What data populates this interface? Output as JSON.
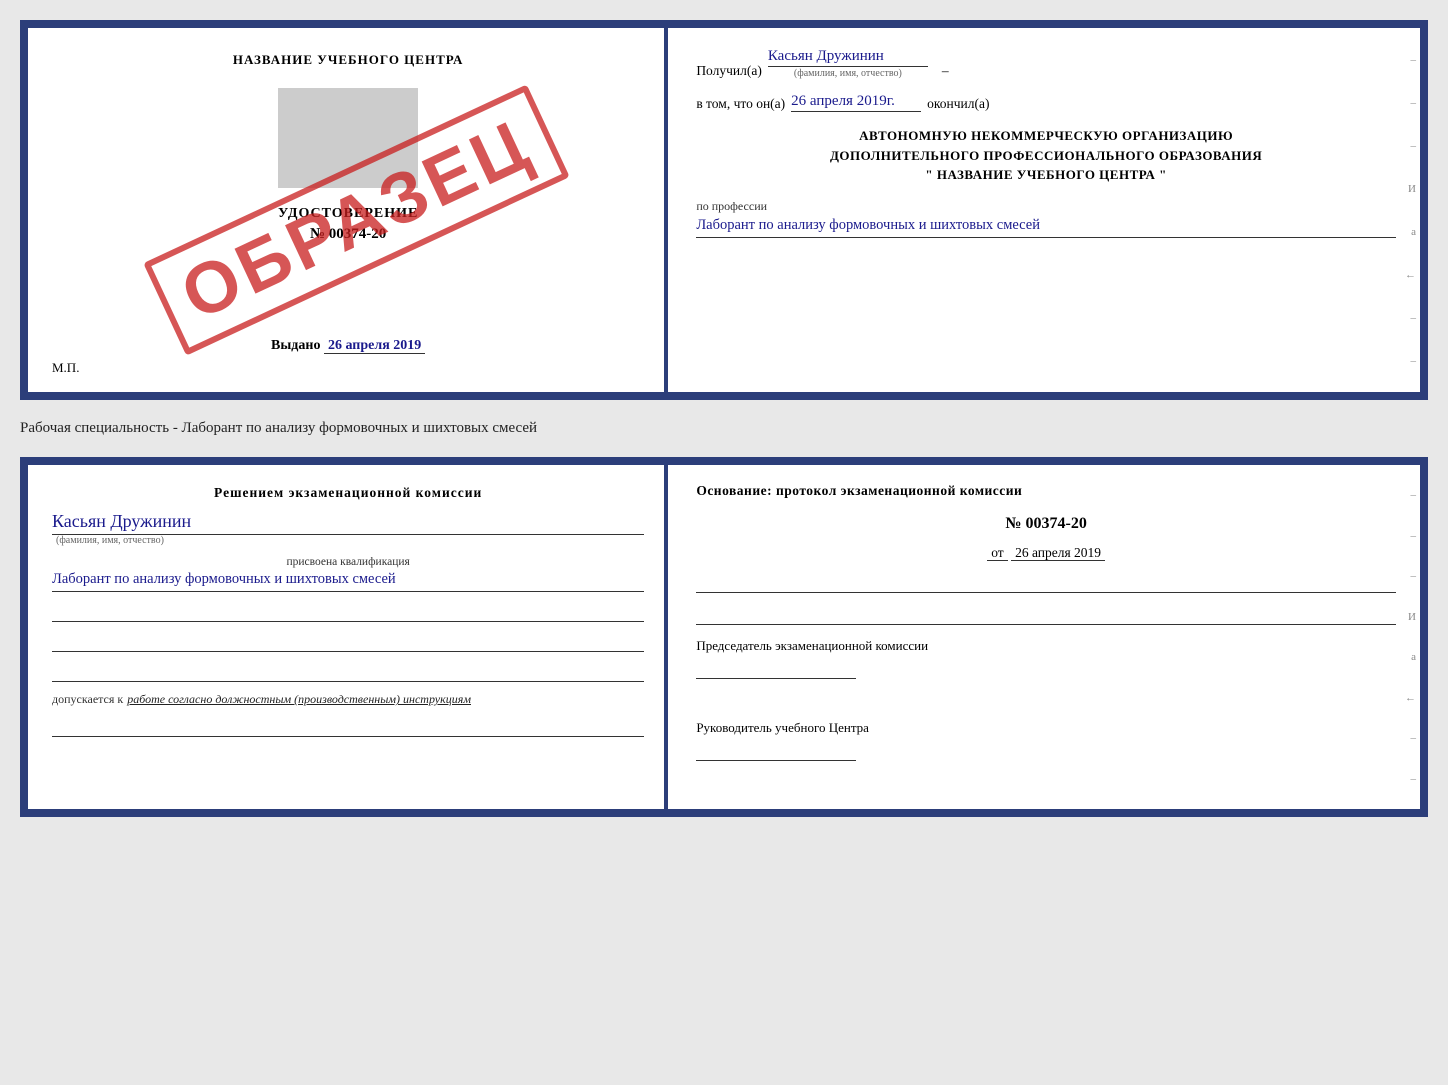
{
  "top_doc": {
    "left": {
      "title": "НАЗВАНИЕ УЧЕБНОГО ЦЕНТРА",
      "cert_label": "УДОСТОВЕРЕНИЕ",
      "cert_number": "№ 00374-20",
      "issued_prefix": "Выдано",
      "issued_date": "26 апреля 2019",
      "mp_label": "М.П.",
      "stamp": "ОБРАЗЕЦ"
    },
    "right": {
      "received_prefix": "Получил(а)",
      "received_name": "Касьян Дружинин",
      "received_name_subtitle": "(фамилия, имя, отчество)",
      "date_prefix": "в том, что он(а)",
      "date_value": "26 апреля 2019г.",
      "date_suffix": "окончил(а)",
      "org_line1": "АВТОНОМНУЮ НЕКОММЕРЧЕСКУЮ ОРГАНИЗАЦИЮ",
      "org_line2": "ДОПОЛНИТЕЛЬНОГО ПРОФЕССИОНАЛЬНОГО ОБРАЗОВАНИЯ",
      "org_line3": "\"   НАЗВАНИЕ УЧЕБНОГО ЦЕНТРА   \"",
      "profession_prefix": "по профессии",
      "profession_value": "Лаборант по анализу формовочных и шихтовых смесей",
      "side_dashes": [
        "-",
        "-",
        "-",
        "И",
        "а",
        "←",
        "-",
        "-"
      ]
    }
  },
  "between": {
    "label": "Рабочая специальность - Лаборант по анализу формовочных и шихтовых смесей"
  },
  "bottom_doc": {
    "left": {
      "decision_text": "Решением экзаменационной комиссии",
      "name_value": "Касьян Дружинин",
      "name_subtitle": "(фамилия, имя, отчество)",
      "qualification_label": "присвоена квалификация",
      "qualification_value": "Лаборант по анализу формовочных и шихтовых смесей",
      "allowed_prefix": "допускается к",
      "allowed_text": "работе согласно должностным (производственным) инструкциям"
    },
    "right": {
      "basis_text": "Основание: протокол экзаменационной комиссии",
      "protocol_number": "№ 00374-20",
      "date_prefix": "от",
      "date_value": "26 апреля 2019",
      "chairman_label": "Председатель экзаменационной комиссии",
      "director_label": "Руководитель учебного Центра",
      "side_dashes": [
        "-",
        "-",
        "-",
        "И",
        "а",
        "←",
        "-",
        "-"
      ]
    }
  }
}
